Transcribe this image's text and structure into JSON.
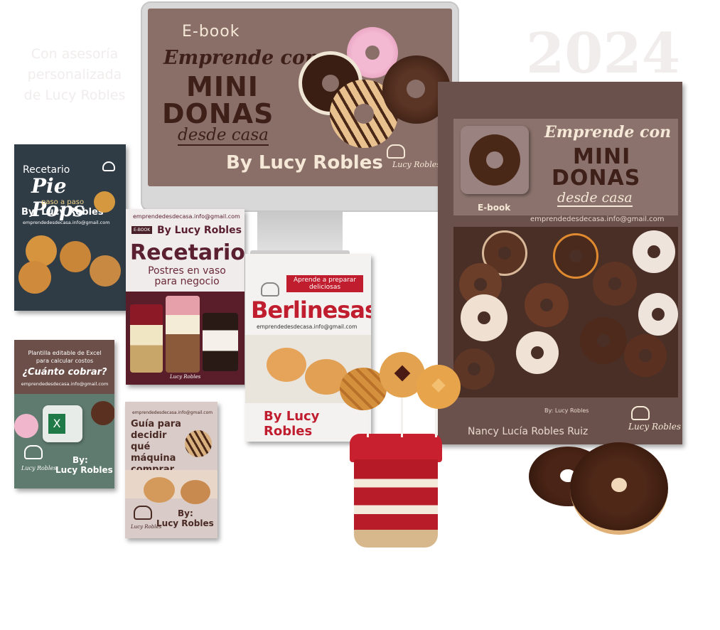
{
  "background_text": {
    "year": "2024",
    "line1": "Con asesoría",
    "line2": "personalizada",
    "line3": "de Lucy Robles"
  },
  "monitor_ebook": {
    "label": "E-book",
    "title_line1": "Emprende con",
    "title_big1": "MINI",
    "title_big2": "DONAS",
    "title_line3": "desde casa",
    "author": "By Lucy Robles",
    "logo": "Lucy Robles"
  },
  "main_book": {
    "title_line1": "Emprende con",
    "title_big1": "MINI",
    "title_big2": "DONAS",
    "title_line3": "desde casa",
    "label": "E-book",
    "email": "emprendedesdecasa.info@gmail.com",
    "by_small": "By: Lucy Robles",
    "author_full": "Nancy Lucía Robles Ruiz",
    "logo": "Lucy Robles"
  },
  "pie_pops": {
    "line1": "Recetario",
    "title": "Pie Pops",
    "subtitle": "paso a paso",
    "author": "By: Lucy Robles",
    "email": "emprendedesdecasa.info@gmail.com"
  },
  "cuanto_cobrar": {
    "line1": "Plantilla editable de Excel",
    "line2": "para calcular costos",
    "title": "¿Cuánto cobrar?",
    "email": "emprendedesdecasa.info@gmail.com",
    "by": "By:",
    "author": "Lucy Robles",
    "logo": "Lucy Robles"
  },
  "postres_vaso": {
    "email": "emprendedesdecasa.info@gmail.com",
    "badge": "E-BOOK",
    "author": "By Lucy Robles",
    "title": "Recetario",
    "subtitle": "Postres en vaso para negocio",
    "logo": "Lucy Robles"
  },
  "berlinesas": {
    "tag": "Aprende a preparar deliciosas",
    "title": "Berlinesas",
    "email": "emprendedesdecasa.info@gmail.com",
    "author": "By Lucy Robles"
  },
  "guia_maquina": {
    "email": "emprendedesdecasa.info@gmail.com",
    "title": "Guía para decidir qué máquina comprar",
    "by": "By:",
    "author": "Lucy Robles",
    "logo": "Lucy Robles"
  },
  "icons": [
    "chef-hat-icon",
    "excel-icon"
  ],
  "colors": {
    "brown_dark": "#3e2019",
    "mauve": "#8a6f69",
    "cream": "#f5e8d6",
    "red": "#c01e2e",
    "slate": "#2f3b45",
    "sage": "#5f7a6e"
  }
}
